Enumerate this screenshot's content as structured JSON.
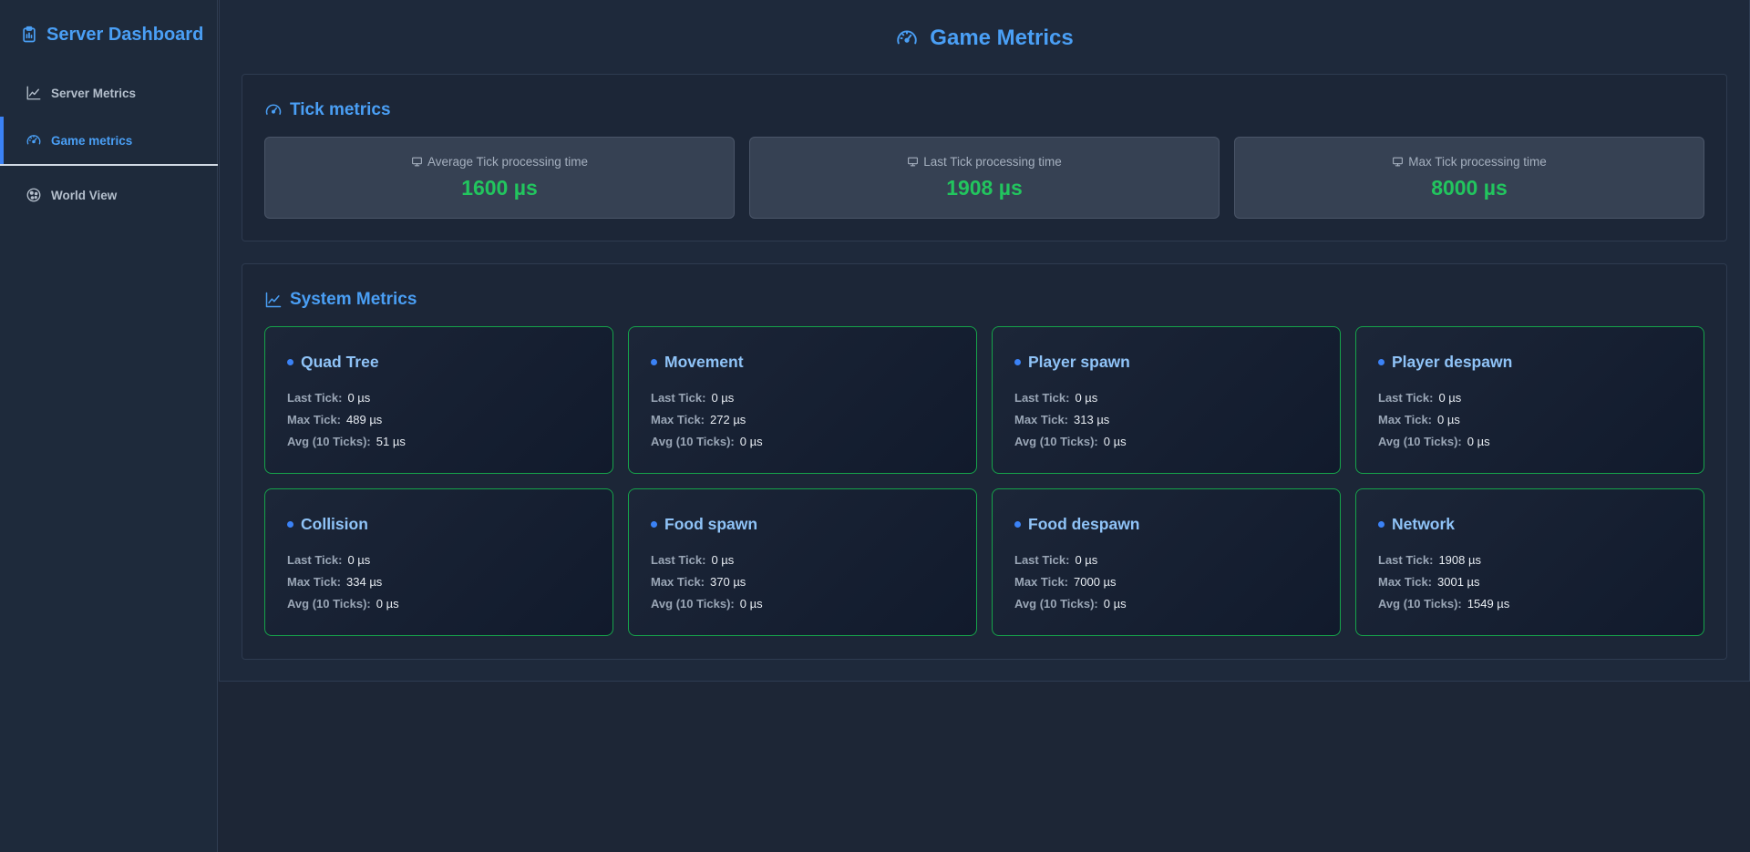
{
  "sidebar": {
    "brand": "Server Dashboard",
    "items": [
      {
        "label": "Server Metrics",
        "icon": "line-chart-icon"
      },
      {
        "label": "Game metrics",
        "icon": "gauge-icon"
      },
      {
        "label": "World View",
        "icon": "globe-icon"
      }
    ],
    "active_index": 1
  },
  "page": {
    "title": "Game Metrics"
  },
  "tick": {
    "title": "Tick metrics",
    "cards": [
      {
        "label": "Average Tick processing time",
        "value": "1600 µs"
      },
      {
        "label": "Last Tick processing time",
        "value": "1908 µs"
      },
      {
        "label": "Max Tick processing time",
        "value": "8000 µs"
      }
    ]
  },
  "system": {
    "title": "System Metrics",
    "row_labels": {
      "last": "Last Tick:",
      "max": "Max Tick:",
      "avg": "Avg (10 Ticks):"
    },
    "cards": [
      {
        "name": "Quad Tree",
        "last": "0 µs",
        "max": "489 µs",
        "avg": "51 µs"
      },
      {
        "name": "Movement",
        "last": "0 µs",
        "max": "272 µs",
        "avg": "0 µs"
      },
      {
        "name": "Player spawn",
        "last": "0 µs",
        "max": "313 µs",
        "avg": "0 µs"
      },
      {
        "name": "Player despawn",
        "last": "0 µs",
        "max": "0 µs",
        "avg": "0 µs"
      },
      {
        "name": "Collision",
        "last": "0 µs",
        "max": "334 µs",
        "avg": "0 µs"
      },
      {
        "name": "Food spawn",
        "last": "0 µs",
        "max": "370 µs",
        "avg": "0 µs"
      },
      {
        "name": "Food despawn",
        "last": "0 µs",
        "max": "7000 µs",
        "avg": "0 µs"
      },
      {
        "name": "Network",
        "last": "1908 µs",
        "max": "3001 µs",
        "avg": "1549 µs"
      }
    ]
  },
  "colors": {
    "accent": "#4a9ff5",
    "value_green": "#22c55e",
    "card_border_green": "#16a34a"
  }
}
